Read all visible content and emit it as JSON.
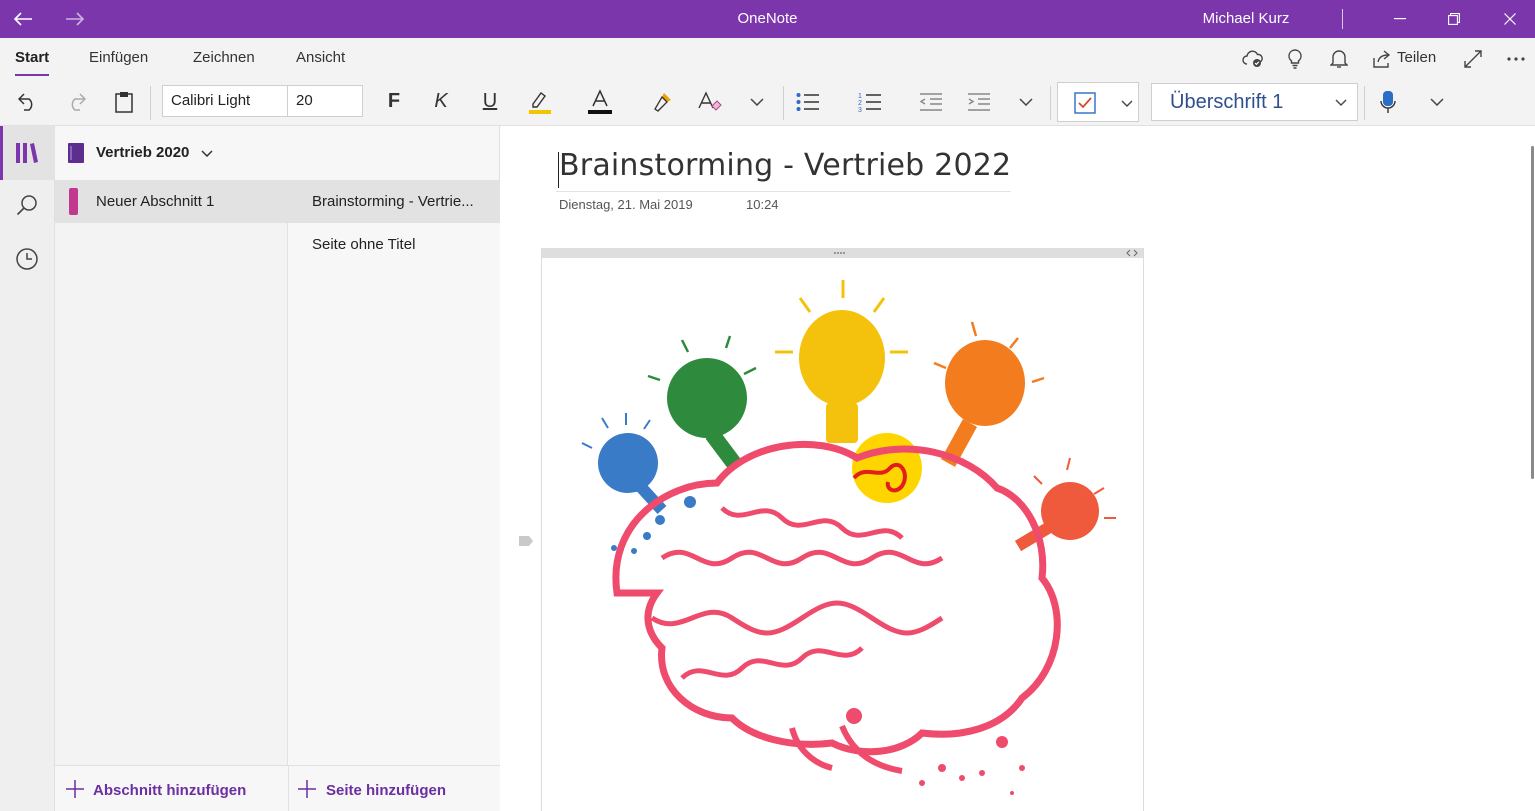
{
  "titlebar": {
    "app_title": "OneNote",
    "user_name": "Michael Kurz",
    "accent_color": "#7b36ab"
  },
  "ribbon_tabs": [
    "Start",
    "Einfügen",
    "Zeichnen",
    "Ansicht"
  ],
  "ribbon_tabs_active": "Start",
  "ribbon_right": {
    "share_label": "Teilen"
  },
  "toolbar": {
    "font_name": "Calibri Light",
    "font_size": "20",
    "bold_glyph": "F",
    "italic_glyph": "K",
    "underline_glyph": "U",
    "font_color_glyph": "A",
    "style_name": "Überschrift 1"
  },
  "notebook": {
    "name": "Vertrieb 2020"
  },
  "sections": [
    {
      "label": "Neuer Abschnitt 1",
      "color": "#c2378f"
    }
  ],
  "pages": [
    {
      "label": "Brainstorming - Vertrie...",
      "active": true
    },
    {
      "label": "Seite ohne Titel",
      "active": false
    }
  ],
  "footer": {
    "add_section": "Abschnitt hinzufügen",
    "add_page": "Seite hinzufügen"
  },
  "page": {
    "title": "Brainstorming - Vertrieb 2022",
    "date": "Dienstag, 21. Mai 2019",
    "time": "10:24",
    "image_description_icon": "brain-lightbulbs-image"
  }
}
